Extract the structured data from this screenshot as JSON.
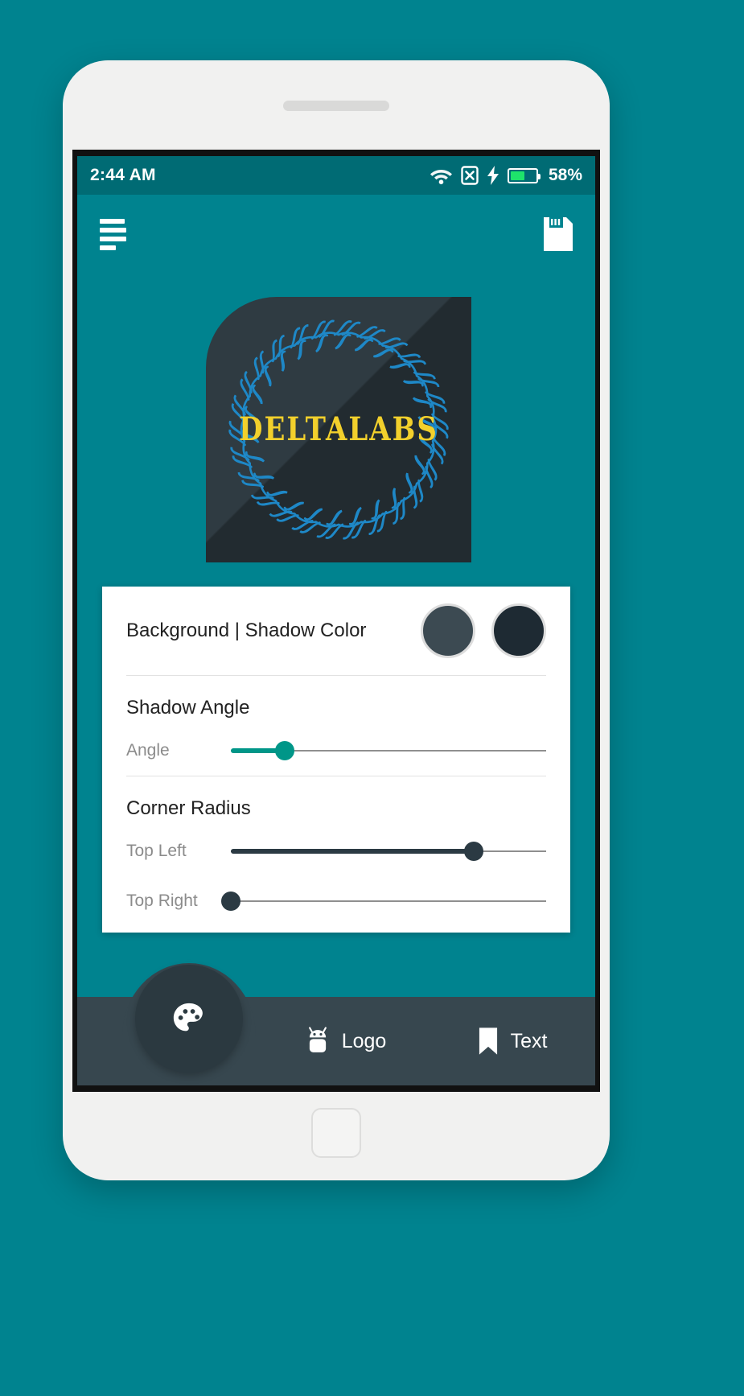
{
  "status_bar": {
    "time": "2:44 AM",
    "battery_percent": "58%",
    "battery_level": 58,
    "icons": [
      "wifi-icon",
      "no-sim-icon",
      "charging-bolt-icon",
      "battery-icon"
    ],
    "background_color": "#006b74"
  },
  "app_bar": {
    "menu_icon": "hamburger-menu-icon",
    "save_icon": "save-icon",
    "background_color": "#00838f"
  },
  "logo_preview": {
    "wordmark": "DELTALABS",
    "wordmark_color": "#f2d02c",
    "background_color": "#2f3b42",
    "wreath_color": "#1e88c7",
    "shadow_enabled": true
  },
  "settings_card": {
    "color_section": {
      "label": "Background | Shadow Color",
      "swatches": [
        {
          "name": "background-color-swatch",
          "color": "#3c4a52"
        },
        {
          "name": "shadow-color-swatch",
          "color": "#1e2a33"
        }
      ]
    },
    "shadow_angle_section": {
      "title": "Shadow Angle",
      "sliders": [
        {
          "label": "Angle",
          "value": 17,
          "fill_color": "#009688",
          "thumb_color": "#009688"
        }
      ]
    },
    "corner_radius_section": {
      "title": "Corner Radius",
      "sliders": [
        {
          "label": "Top Left",
          "value": 77,
          "fill_color": "#2b3a43",
          "thumb_color": "#2b3a43"
        },
        {
          "label": "Top Right",
          "value": 0,
          "fill_color": "#2b3a43",
          "thumb_color": "#2b3a43"
        }
      ]
    }
  },
  "bottom_nav": {
    "background_color": "#37474f",
    "fab": {
      "icon": "palette-icon",
      "name": "color-tab"
    },
    "items": [
      {
        "icon": "android-robot-icon",
        "label": "Logo"
      },
      {
        "icon": "bookmark-icon",
        "label": "Text"
      }
    ]
  }
}
